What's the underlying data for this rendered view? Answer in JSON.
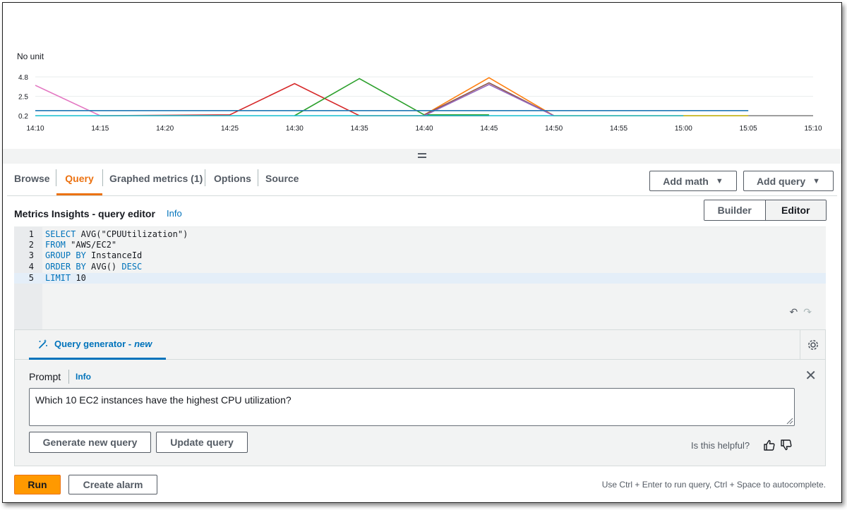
{
  "chart_data": {
    "type": "line",
    "unit_label": "No unit",
    "x_ticks": [
      "14:10",
      "14:15",
      "14:20",
      "14:25",
      "14:30",
      "14:35",
      "14:40",
      "14:45",
      "14:50",
      "14:55",
      "15:00",
      "15:05",
      "15:10"
    ],
    "y_ticks": [
      "4.8",
      "2.5",
      "0.2"
    ],
    "ylim": [
      0.2,
      4.8
    ],
    "grid": true,
    "series": [
      {
        "color": "#e377c2",
        "x": [
          "14:10",
          "14:15"
        ],
        "y": [
          3.8,
          0.2
        ]
      },
      {
        "color": "#d62728",
        "x": [
          "14:15",
          "14:25",
          "14:30",
          "14:35",
          "14:45"
        ],
        "y": [
          0.2,
          0.3,
          4.0,
          0.2,
          0.2
        ]
      },
      {
        "color": "#2ca02c",
        "x": [
          "14:30",
          "14:35",
          "14:40",
          "14:45"
        ],
        "y": [
          0.2,
          4.6,
          0.3,
          0.3
        ]
      },
      {
        "color": "#ff7f0e",
        "x": [
          "14:40",
          "14:45",
          "14:50",
          "15:05"
        ],
        "y": [
          0.3,
          4.7,
          0.2,
          0.2
        ]
      },
      {
        "color": "#8c564b",
        "x": [
          "14:40",
          "14:45",
          "14:50"
        ],
        "y": [
          0.3,
          4.1,
          0.2
        ]
      },
      {
        "color": "#9467bd",
        "x": [
          "14:40",
          "14:45",
          "14:50"
        ],
        "y": [
          0.2,
          3.9,
          0.2
        ]
      },
      {
        "color": "#1f77b4",
        "x": [
          "14:10",
          "15:05"
        ],
        "y": [
          0.8,
          0.8
        ]
      },
      {
        "color": "#17becf",
        "x": [
          "14:10",
          "15:00"
        ],
        "y": [
          0.2,
          0.2
        ]
      },
      {
        "color": "#bcbd22",
        "x": [
          "15:00",
          "15:05"
        ],
        "y": [
          0.2,
          0.2
        ]
      },
      {
        "color": "#7f7f7f",
        "x": [
          "15:05",
          "15:10"
        ],
        "y": [
          0.2,
          0.2
        ]
      }
    ]
  },
  "tabs": [
    "Browse",
    "Query",
    "Graphed metrics (1)",
    "Options",
    "Source"
  ],
  "active_tab": "Query",
  "actions": {
    "add_math": "Add math",
    "add_query": "Add query"
  },
  "editor": {
    "title": "Metrics Insights - query editor",
    "info": "Info",
    "modes": [
      "Builder",
      "Editor"
    ],
    "selected_mode": "Editor",
    "lines": [
      {
        "num": "1",
        "kw": "SELECT",
        "rest": " AVG(\"CPUUtilization\")"
      },
      {
        "num": "2",
        "kw": "FROM",
        "rest": " \"AWS/EC2\""
      },
      {
        "num": "3",
        "kw": "GROUP BY",
        "rest": " InstanceId"
      },
      {
        "num": "4",
        "kw": "ORDER BY",
        "rest": " AVG() ",
        "kw2": "DESC"
      },
      {
        "num": "5",
        "kw": "LIMIT",
        "rest": " 10"
      }
    ]
  },
  "query_generator": {
    "tab_label": "Query generator -",
    "tab_badge": "new",
    "prompt_label": "Prompt",
    "info": "Info",
    "prompt_value": "Which 10 EC2 instances have the highest CPU utilization?",
    "generate_label": "Generate new query",
    "update_label": "Update query",
    "helpful_text": "Is this helpful?"
  },
  "footer": {
    "run_label": "Run",
    "create_alarm_label": "Create alarm",
    "hint": "Use Ctrl + Enter to run query, Ctrl + Space to autocomplete."
  }
}
